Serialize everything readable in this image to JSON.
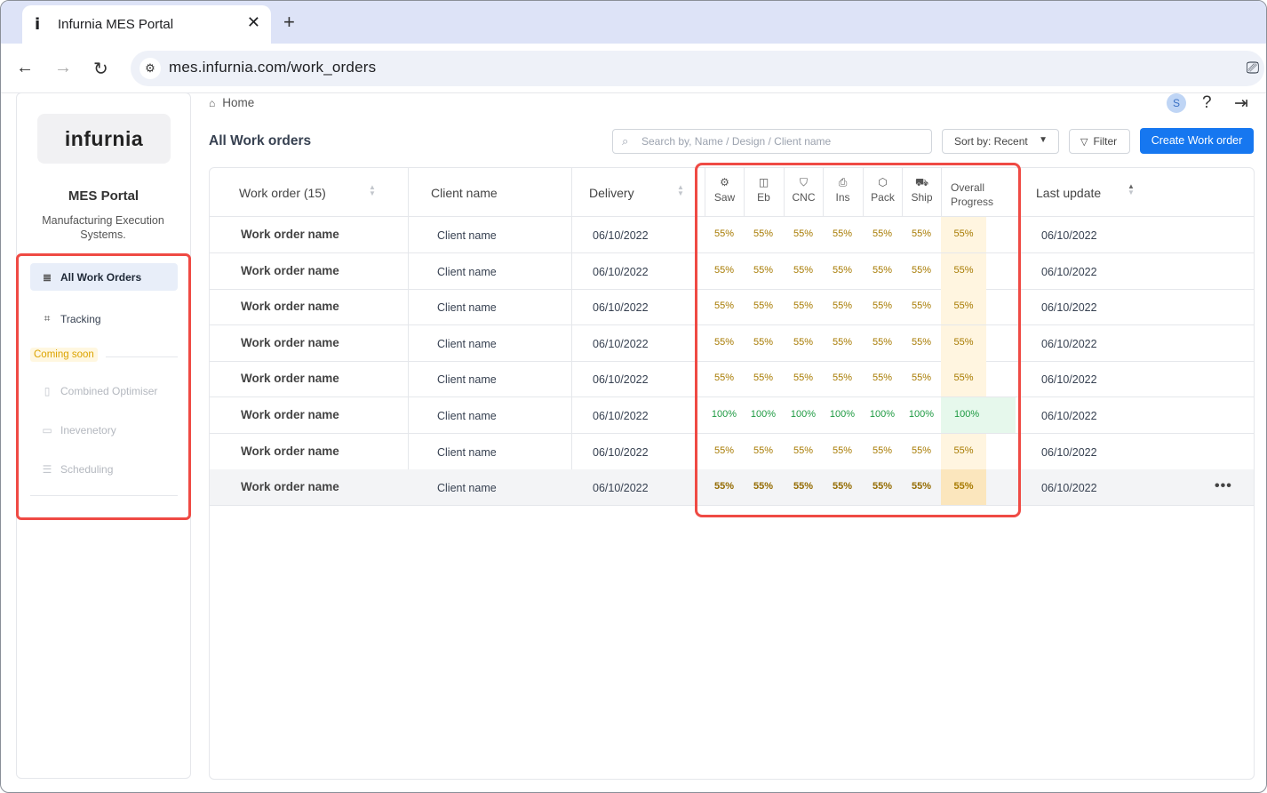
{
  "browser": {
    "tab_title": "Infurnia MES Portal",
    "tab_favicon": "i",
    "tab_close": "✕",
    "new_tab": "+",
    "url": "mes.infurnia.com/work_orders"
  },
  "sidebar": {
    "logo": "infurnia",
    "title": "MES Portal",
    "subtitle": "Manufacturing Execution Systems.",
    "items": [
      {
        "label": "All Work Orders",
        "icon": "list-icon",
        "active": true
      },
      {
        "label": "Tracking",
        "icon": "tracking-icon"
      }
    ],
    "coming_soon_label": "Coming soon",
    "coming_soon_items": [
      {
        "label": "Combined Optimiser",
        "icon": "optimiser-icon"
      },
      {
        "label": "Inevenetory",
        "icon": "inventory-icon"
      },
      {
        "label": "Scheduling",
        "icon": "scheduling-icon"
      }
    ]
  },
  "header": {
    "breadcrumb": "Home",
    "avatar_initial": "S",
    "help": "?",
    "logout": "⇥"
  },
  "toolbar": {
    "page_title": "All Work orders",
    "search_placeholder": "Search by, Name / Design / Client name",
    "sort_label": "Sort by:  Recent",
    "filter_label": "Filter",
    "create_label": "Create Work order"
  },
  "table": {
    "columns": {
      "work_order": "Work order (15)",
      "client": "Client name",
      "delivery": "Delivery",
      "overall_line1": "Overall",
      "overall_line2": "Progress",
      "last_update": "Last update"
    },
    "stages": [
      {
        "label": "Saw",
        "icon": "saw-icon",
        "glyph": "⚙"
      },
      {
        "label": "Eb",
        "icon": "edgeband-icon",
        "glyph": "◫"
      },
      {
        "label": "CNC",
        "icon": "cnc-icon",
        "glyph": "⛉"
      },
      {
        "label": "Ins",
        "icon": "inspection-icon",
        "glyph": "⎙"
      },
      {
        "label": "Pack",
        "icon": "package-icon",
        "glyph": "⬡"
      },
      {
        "label": "Ship",
        "icon": "truck-icon",
        "glyph": "⛟"
      }
    ],
    "rows": [
      {
        "name": "Work order name",
        "client": "Client name",
        "delivery": "06/10/2022",
        "stages": [
          "55%",
          "55%",
          "55%",
          "55%",
          "55%",
          "55%"
        ],
        "overall": "55%",
        "last_update": "06/10/2022"
      },
      {
        "name": "Work order name",
        "client": "Client name",
        "delivery": "06/10/2022",
        "stages": [
          "55%",
          "55%",
          "55%",
          "55%",
          "55%",
          "55%"
        ],
        "overall": "55%",
        "last_update": "06/10/2022"
      },
      {
        "name": "Work order name",
        "client": "Client name",
        "delivery": "06/10/2022",
        "stages": [
          "55%",
          "55%",
          "55%",
          "55%",
          "55%",
          "55%"
        ],
        "overall": "55%",
        "last_update": "06/10/2022"
      },
      {
        "name": "Work order name",
        "client": "Client name",
        "delivery": "06/10/2022",
        "stages": [
          "55%",
          "55%",
          "55%",
          "55%",
          "55%",
          "55%"
        ],
        "overall": "55%",
        "last_update": "06/10/2022"
      },
      {
        "name": "Work order name",
        "client": "Client name",
        "delivery": "06/10/2022",
        "stages": [
          "55%",
          "55%",
          "55%",
          "55%",
          "55%",
          "55%"
        ],
        "overall": "55%",
        "last_update": "06/10/2022"
      },
      {
        "name": "Work order name",
        "client": "Client name",
        "delivery": "06/10/2022",
        "stages": [
          "100%",
          "100%",
          "100%",
          "100%",
          "100%",
          "100%"
        ],
        "overall": "100%",
        "last_update": "06/10/2022"
      },
      {
        "name": "Work order name",
        "client": "Client name",
        "delivery": "06/10/2022",
        "stages": [
          "55%",
          "55%",
          "55%",
          "55%",
          "55%",
          "55%"
        ],
        "overall": "55%",
        "last_update": "06/10/2022"
      },
      {
        "name": "Work order name",
        "client": "Client name",
        "delivery": "06/10/2022",
        "stages": [
          "55%",
          "55%",
          "55%",
          "55%",
          "55%",
          "55%"
        ],
        "overall": "55%",
        "last_update": "06/10/2022",
        "selected": true
      }
    ],
    "row_menu": "•••"
  },
  "colors": {
    "primary": "#1677f0",
    "in_progress": "#a77a00",
    "complete": "#1e9a42",
    "highlight_border": "#ef4a44"
  }
}
